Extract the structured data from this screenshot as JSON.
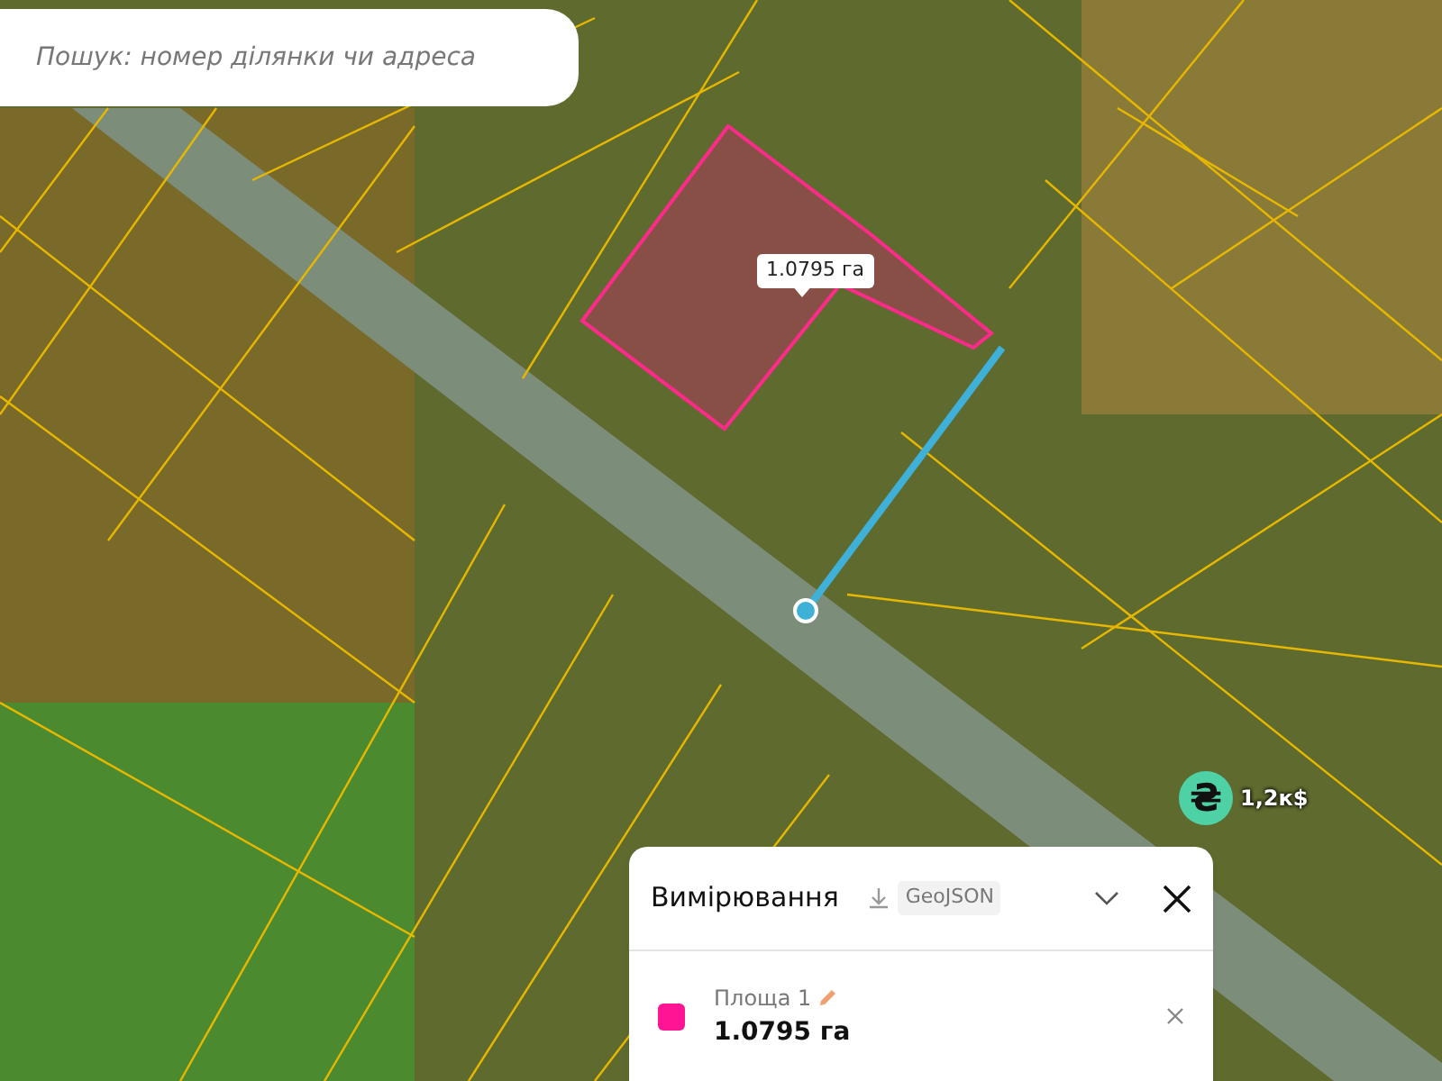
{
  "search": {
    "placeholder": "Пошук: номер ділянки чи адреса"
  },
  "map": {
    "area_label": "1.0795 га",
    "price_marker": {
      "symbol": "₴",
      "label": "1,2к$"
    }
  },
  "panel": {
    "title": "Вимірювання",
    "export_label": "GeoJSON",
    "expanded": true,
    "items": [
      {
        "name": "Площа 1",
        "value": "1.0795 га",
        "color": "#ff1493"
      }
    ]
  }
}
